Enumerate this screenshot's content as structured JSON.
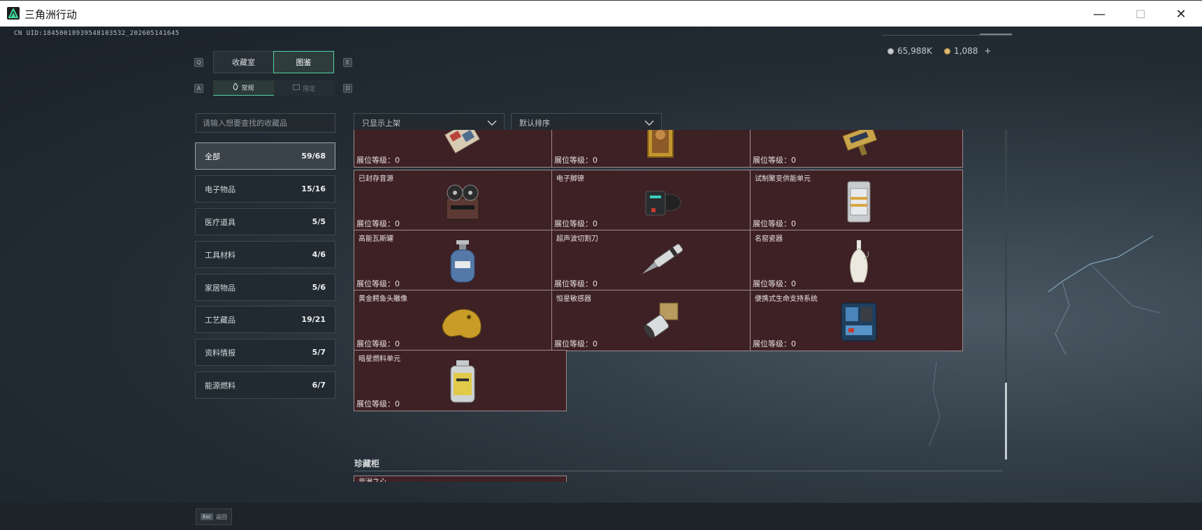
{
  "window": {
    "title": "三角洲行动",
    "minimize": "—",
    "maximize": "☐",
    "close": "✕"
  },
  "uid": "CN UID:18450018939548103532_202605141645",
  "currency": {
    "silver": "65,988K",
    "gold": "1,088",
    "add": "+"
  },
  "key_hints": {
    "tab_prev": "Q",
    "tab_next": "E",
    "sub_prev": "A",
    "sub_next": "D"
  },
  "tabs": [
    {
      "label": "收藏室"
    },
    {
      "label": "图鉴"
    }
  ],
  "subtabs": [
    {
      "label": "常规"
    },
    {
      "label": "限定"
    }
  ],
  "search": {
    "placeholder": "请输入想要查找的收藏品"
  },
  "filters": {
    "shelf": "只显示上架",
    "sort": "默认排序"
  },
  "categories": [
    {
      "label": "全部",
      "count": "59/68"
    },
    {
      "label": "电子物品",
      "count": "15/16"
    },
    {
      "label": "医疗道具",
      "count": "5/5"
    },
    {
      "label": "工具材料",
      "count": "4/6"
    },
    {
      "label": "家居物品",
      "count": "5/6"
    },
    {
      "label": "工艺藏品",
      "count": "19/21"
    },
    {
      "label": "资料情报",
      "count": "5/7"
    },
    {
      "label": "能源燃料",
      "count": "6/7"
    }
  ],
  "items": [
    {
      "name": "",
      "level": "展位等级：0",
      "icon": "map-scroll-icon"
    },
    {
      "name": "",
      "level": "展位等级：0",
      "icon": "gold-frame-painting-icon"
    },
    {
      "name": "",
      "level": "展位等级：0",
      "icon": "gold-device-icon"
    },
    {
      "name": "已封存音源",
      "level": "展位等级：0",
      "icon": "reel-tape-recorder-icon"
    },
    {
      "name": "电子脚镣",
      "level": "展位等级：0",
      "icon": "electronic-ankle-monitor-icon"
    },
    {
      "name": "试制聚变供能单元",
      "level": "展位等级：0",
      "icon": "fusion-power-unit-icon"
    },
    {
      "name": "高能瓦斯罐",
      "level": "展位等级：0",
      "icon": "gas-canister-icon"
    },
    {
      "name": "超声波切割刀",
      "level": "展位等级：0",
      "icon": "ultrasonic-cutter-icon"
    },
    {
      "name": "名窑瓷器",
      "level": "展位等级：0",
      "icon": "porcelain-vase-icon"
    },
    {
      "name": "黄金鳄鱼头雕像",
      "level": "展位等级：0",
      "icon": "gold-crocodile-statue-icon"
    },
    {
      "name": "恒星敏感器",
      "level": "展位等级：0",
      "icon": "star-sensor-icon"
    },
    {
      "name": "便携式生命支持系统",
      "level": "展位等级：0",
      "icon": "life-support-system-icon"
    },
    {
      "name": "暗星燃料单元",
      "level": "展位等级：0",
      "icon": "fuel-cell-icon"
    }
  ],
  "section": {
    "title": "珍藏柜",
    "first_item": "非洲之心"
  },
  "footer": {
    "esc_key": "Esc",
    "esc_label": "返回"
  },
  "colors": {
    "accent": "#57d2a4",
    "card_bg": "#3e2125",
    "card_border": "#9b8c8d"
  }
}
